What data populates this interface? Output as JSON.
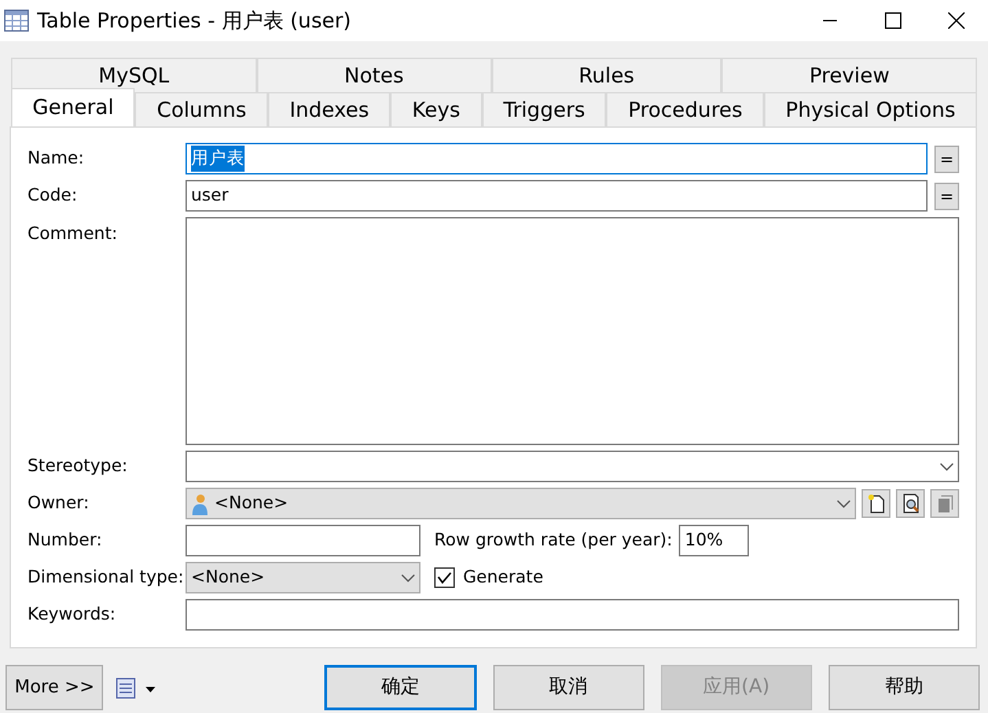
{
  "window": {
    "title": "Table Properties - 用户表 (user)"
  },
  "tab_rows": [
    [
      {
        "label": "MySQL",
        "selected": false
      },
      {
        "label": "Notes",
        "selected": false
      },
      {
        "label": "Rules",
        "selected": false
      },
      {
        "label": "Preview",
        "selected": false
      }
    ],
    [
      {
        "label": "General",
        "selected": true
      },
      {
        "label": "Columns",
        "selected": false
      },
      {
        "label": "Indexes",
        "selected": false
      },
      {
        "label": "Keys",
        "selected": false
      },
      {
        "label": "Triggers",
        "selected": false
      },
      {
        "label": "Procedures",
        "selected": false
      },
      {
        "label": "Physical Options",
        "selected": false
      }
    ]
  ],
  "fields": [
    {
      "kind": "text",
      "label": "Name:",
      "value": "用户表",
      "text_selected": true,
      "focused": true,
      "button": "="
    },
    {
      "kind": "text",
      "label": "Code:",
      "value": "user",
      "text_selected": false,
      "focused": false,
      "button": "="
    },
    {
      "kind": "memo",
      "label": "Comment:"
    },
    {
      "kind": "combo",
      "label": "Stereotype:"
    },
    {
      "kind": "owner",
      "label": "Owner:",
      "value": "<None>"
    },
    {
      "kind": "pair",
      "label": "Number:",
      "second_label": "Row growth rate (per year):",
      "second_value": "10%"
    },
    {
      "kind": "select_check",
      "label": "Dimensional type:",
      "value": "<None>",
      "check_label": "Generate",
      "checked": true
    },
    {
      "kind": "text",
      "label": "Keywords:",
      "focused": false
    }
  ],
  "footer": {
    "more": "More >>",
    "buttons": [
      {
        "label": "确定",
        "default": true,
        "disabled": false
      },
      {
        "label": "取消",
        "default": false,
        "disabled": false
      },
      {
        "label": "应用(A)",
        "default": false,
        "disabled": true
      },
      {
        "label": "帮助",
        "default": false,
        "disabled": false
      }
    ]
  }
}
